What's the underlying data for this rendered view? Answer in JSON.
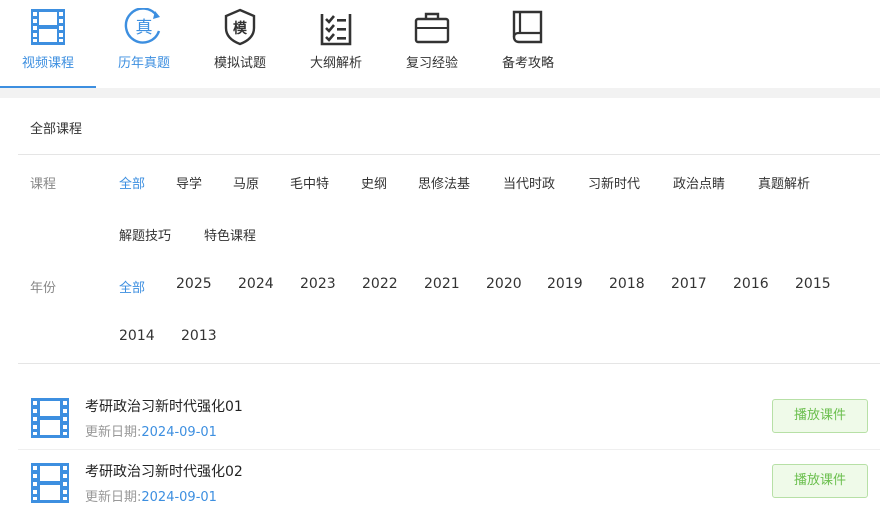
{
  "nav": {
    "items": [
      {
        "label": "视频课程",
        "icon": "film-icon",
        "active": true
      },
      {
        "label": "历年真题",
        "icon": "zhen-badge-icon",
        "badge_char": "真"
      },
      {
        "label": "模拟试题",
        "icon": "mo-shield-icon",
        "badge_char": "模"
      },
      {
        "label": "大纲解析",
        "icon": "checklist-icon"
      },
      {
        "label": "复习经验",
        "icon": "briefcase-icon"
      },
      {
        "label": "备考攻略",
        "icon": "book-icon"
      }
    ]
  },
  "section_title": "全部课程",
  "filters": {
    "course": {
      "label": "课程",
      "options": [
        "全部",
        "导学",
        "马原",
        "毛中特",
        "史纲",
        "思修法基",
        "当代时政",
        "习新时代",
        "政治点睛",
        "真题解析",
        "解题技巧",
        "特色课程"
      ],
      "selected": "全部"
    },
    "year": {
      "label": "年份",
      "options": [
        "全部",
        "2025",
        "2024",
        "2023",
        "2022",
        "2021",
        "2020",
        "2019",
        "2018",
        "2017",
        "2016",
        "2015",
        "2014",
        "2013"
      ],
      "selected": "全部"
    }
  },
  "courses": [
    {
      "title": "考研政治习新时代强化01",
      "date_label": "更新日期:",
      "date": "2024-09-01",
      "button": "播放课件"
    },
    {
      "title": "考研政治习新时代强化02",
      "date_label": "更新日期:",
      "date": "2024-09-01",
      "button": "播放课件"
    }
  ],
  "colors": {
    "accent": "#3d8fe0",
    "play_text": "#6bbf4e",
    "play_bg": "#effae9"
  }
}
